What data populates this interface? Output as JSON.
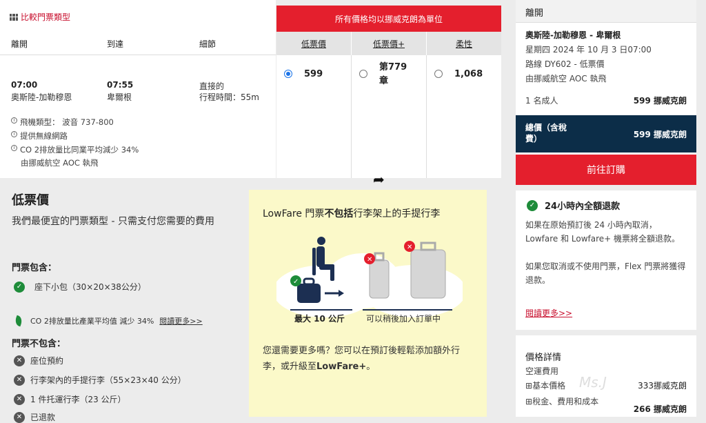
{
  "flight": {
    "compare_label": "比較門票類型",
    "col_depart": "離開",
    "col_arrive": "到達",
    "col_details": "細節",
    "depart_time": "07:00",
    "depart_city": "奧斯陸-加勒穆恩",
    "arrive_time": "07:55",
    "arrive_city": "卑爾根",
    "direct": "直接的",
    "duration": "行程時間：55m",
    "aircraft": "飛機類型： 波音 737-800",
    "wifi": "提供無線網路",
    "co2": "CO 2排放量比同業平均減少 34%",
    "operator": "由挪威航空 AOC 執飛"
  },
  "fares": {
    "banner": "所有價格均以挪威克朗為單位",
    "headers": [
      "低票價",
      "低票價+",
      "柔性"
    ],
    "prices": [
      "599",
      "第779\n章",
      "1,068"
    ],
    "selected_index": 0
  },
  "lowfare": {
    "title": "低票價",
    "desc": "我們最便宜的門票類型 - 只需支付您需要的費用",
    "includes_h": "門票包含：",
    "inc_item": "座下小包（30×20×38公分）",
    "co2_text": "CO 2排放量比產業平均值 減少 34%",
    "read_more": "閱讀更多>>",
    "excludes_h": "門票不包含：",
    "exc_items": [
      "座位預約",
      "行李架內的手提行李（55×23×40 公分）",
      "1 件托運行李（23 公斤）",
      "已退款"
    ]
  },
  "card": {
    "title_a": "LowFare 門票",
    "title_b": "不包括",
    "title_c": "行李架上的手提行李",
    "cap_left": "最大 10 公斤",
    "cap_right": "可以稍後加入訂單中",
    "bottom_a": "您還需要更多嗎？您可以在預訂後輕鬆添加額外行李，或升級至",
    "bottom_b": "LowFare+",
    "bottom_c": "。"
  },
  "summary": {
    "head": "離開",
    "route": "奧斯陸-加勒穆恩 - 卑爾根",
    "date": "星期四 2024 年 10 月 3 日07:00",
    "flight_no": "路線 DY602 - 低票價",
    "operator": "由挪威航空 AOC 執飛",
    "pax": "1 名成人",
    "pax_price": "599 挪威克朗",
    "total_label": "總價（含稅費）",
    "total_price": "599 挪威克朗",
    "book": "前往訂購",
    "refund_title": "24小時內全額退款",
    "refund_p1": "如果在原始預訂後 24 小時內取消，Lowfare 和 Lowfare+ 機票將全額退款。",
    "refund_p2": "如果您取消或不使用門票，Flex 門票將獲得退款。",
    "read_more": "閱讀更多>>",
    "price_details": "價格詳情",
    "airfare": "空運費用",
    "base_label": "基本價格",
    "base_price": "333挪威克朗",
    "tax_label": "稅金、費用和成本",
    "tax_price": "266 挪威克朗",
    "watermark": "Ms.J"
  },
  "colors": {
    "accent_red": "#e41f2d",
    "navy": "#0c2d48",
    "yellow": "#fbf9c9",
    "green": "#1e8c3a"
  }
}
